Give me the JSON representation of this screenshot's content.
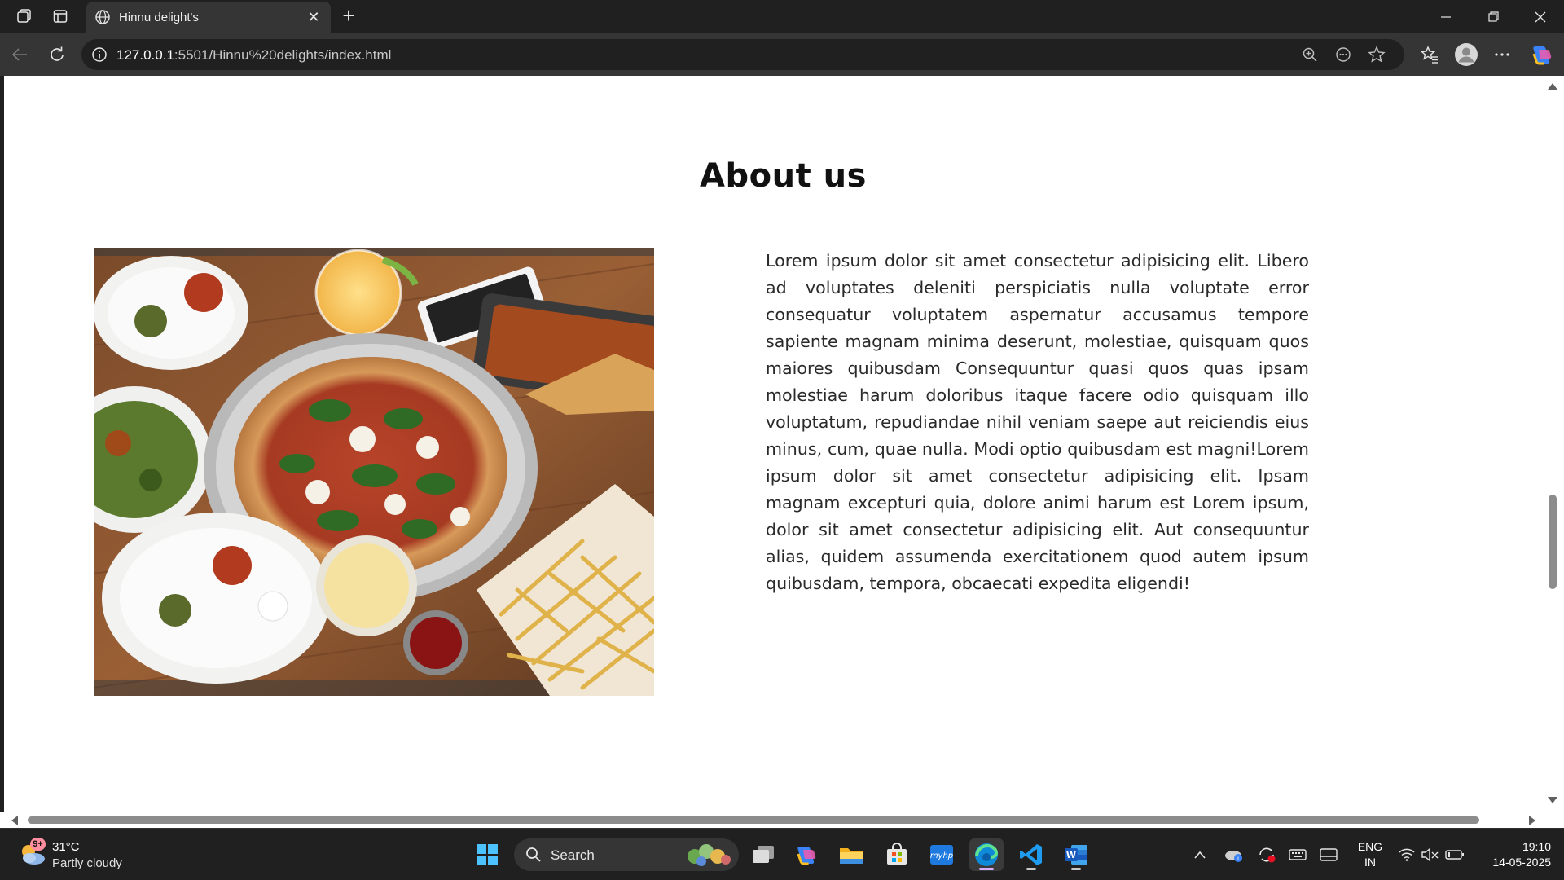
{
  "browser": {
    "tab_title": "Hinnu delight's",
    "url_host": "127.0.0.1",
    "url_rest": ":5501/Hinnu%20delights/index.html"
  },
  "page": {
    "heading": "About us",
    "image_alt": "Table with pizza, fries, drinks and side dishes",
    "paragraph": "Lorem ipsum dolor sit amet consectetur adipisicing elit. Libero ad voluptates deleniti perspiciatis nulla voluptate error consequatur voluptatem aspernatur accusamus tempore sapiente magnam minima deserunt, molestiae, quisquam quos maiores quibusdam Consequuntur quasi quos quas ipsam molestiae harum doloribus itaque facere odio quisquam illo voluptatum, repudiandae nihil veniam saepe aut reiciendis eius minus, cum, quae nulla. Modi optio quibusdam est magni!Lorem ipsum dolor sit amet consectetur adipisicing elit. Ipsam magnam excepturi quia, dolore animi harum est Lorem ipsum, dolor sit amet consectetur adipisicing elit. Aut consequuntur alias, quidem assumenda exercitationem quod autem ipsum quibusdam, tempora, obcaecati expedita eligendi!"
  },
  "taskbar": {
    "weather_temp": "31°C",
    "weather_cond": "Partly cloudy",
    "weather_badge": "9+",
    "search_label": "Search",
    "lang_line1": "ENG",
    "lang_line2": "IN",
    "time": "19:10",
    "date": "14-05-2025",
    "pinned_icons": [
      "start-icon",
      "search-icon",
      "task-view-icon",
      "copilot-icon",
      "file-explorer-icon",
      "microsoft-store-icon",
      "myhp-icon",
      "edge-icon",
      "vscode-icon",
      "word-icon"
    ],
    "tray_icons": [
      "chevron-up-icon",
      "onedrive-icon",
      "sync-icon",
      "keyboard-icon",
      "tablet-icon",
      "wifi-icon",
      "mute-icon",
      "battery-icon"
    ]
  },
  "colors": {
    "chrome_dark": "#202020",
    "chrome_mid": "#353535",
    "page_bg": "#ffffff",
    "text": "#2a2a2a"
  }
}
